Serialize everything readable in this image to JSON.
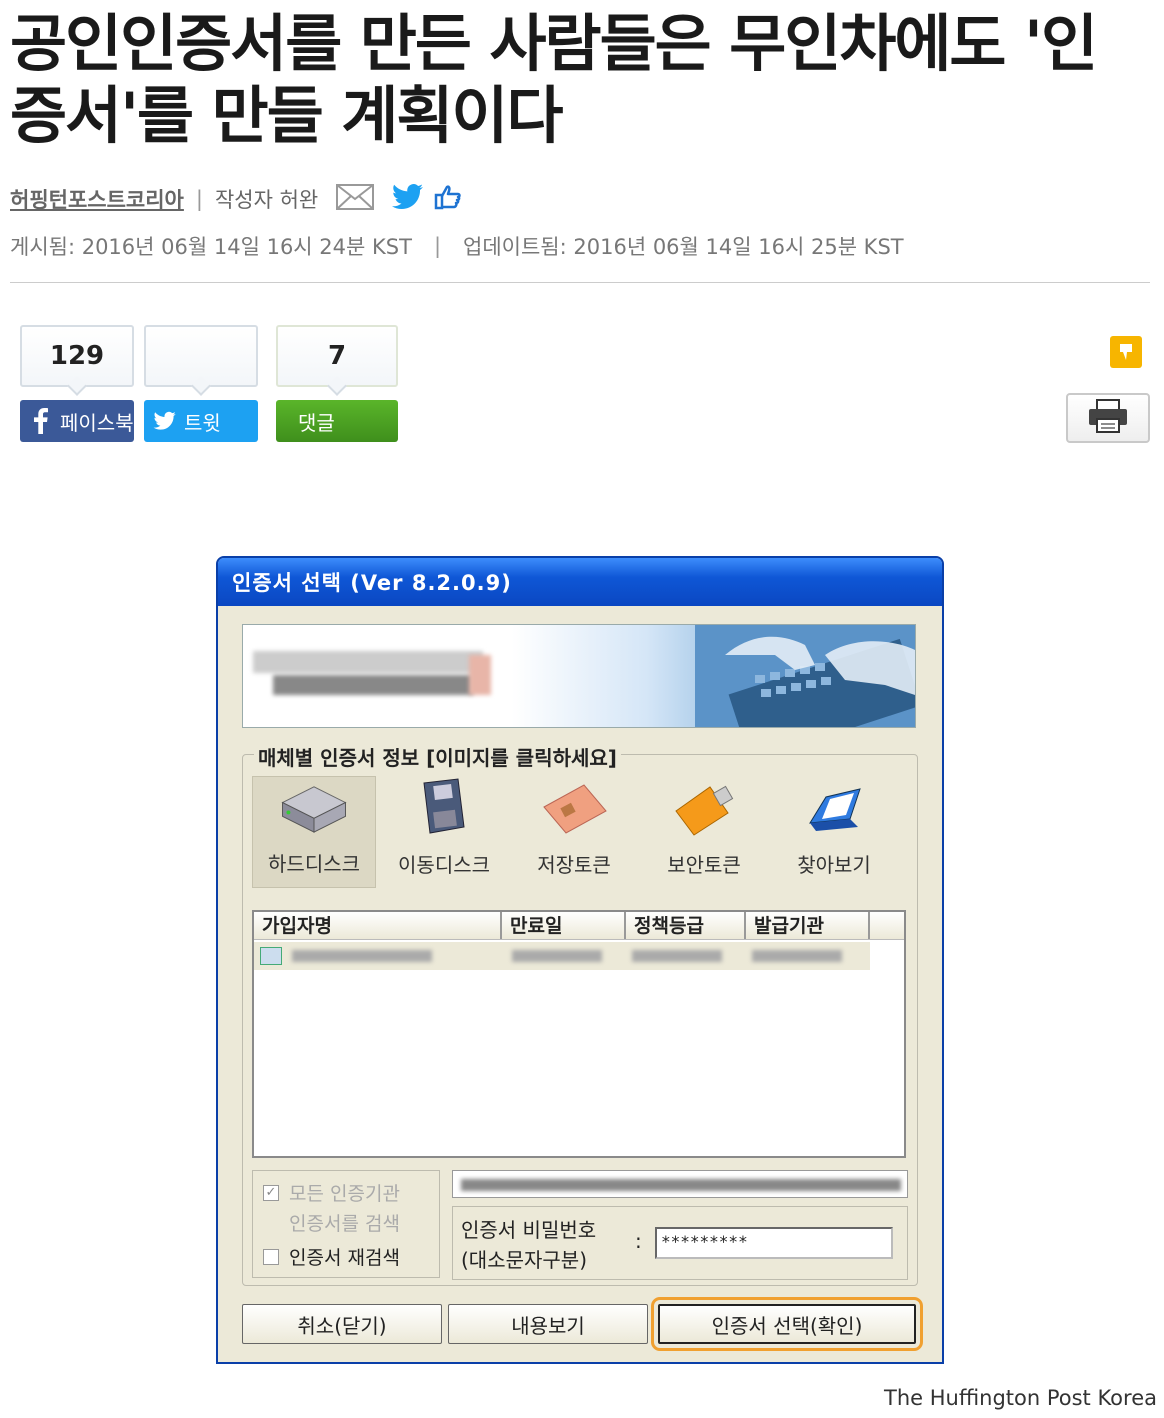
{
  "article": {
    "headline": "공인인증서를 만든 사람들은 무인차에도 '인증서'를 만들 계획이다",
    "publisher": "허핑턴포스트코리아",
    "author": "작성자 허완",
    "published": "게시됨: 2016년 06월 14일 16시 24분 KST",
    "updated": "업데이트됨: 2016년 06월 14일 16시 25분 KST",
    "image_credit": "The Huffington Post Korea"
  },
  "share": {
    "facebook": {
      "count": "129",
      "label": "페이스북"
    },
    "twitter": {
      "count": "",
      "label": "트윗"
    },
    "comments": {
      "count": "7",
      "label": "댓글"
    }
  },
  "dialog": {
    "title": "인증서 선택 (Ver 8.2.0.9)",
    "group_label": "매체별 인증서 정보 [이미지를 클릭하세요]",
    "media": [
      {
        "label": "하드디스크",
        "icon": "hard-disk-icon"
      },
      {
        "label": "이동디스크",
        "icon": "removable-disk-icon"
      },
      {
        "label": "저장토큰",
        "icon": "storage-token-icon"
      },
      {
        "label": "보안토큰",
        "icon": "security-token-icon"
      },
      {
        "label": "찾아보기",
        "icon": "browse-folder-icon"
      }
    ],
    "columns": [
      "가입자명",
      "만료일",
      "정책등급",
      "발급기관"
    ],
    "options": {
      "all_issuers": "모든 인증기관",
      "search_cert": "인증서를 검색",
      "research": "인증서 재검색"
    },
    "password_label_1": "인증서 비밀번호",
    "password_label_2": "(대소문자구분)",
    "password_colon": ":",
    "password_value": "*********",
    "buttons": {
      "cancel": "취소(닫기)",
      "view": "내용보기",
      "confirm": "인증서 선택(확인)"
    }
  }
}
